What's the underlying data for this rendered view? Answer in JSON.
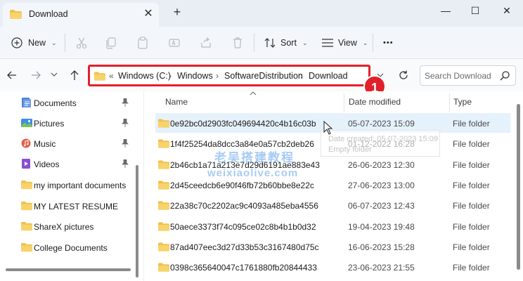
{
  "window": {
    "tab_title": "Download",
    "new_tab_label": "+",
    "close_tab_label": "✕",
    "minimize_label": "—",
    "maximize_label": "☐",
    "close_label": "✕"
  },
  "toolbar": {
    "new_label": "New",
    "sort_label": "Sort",
    "view_label": "View",
    "more_label": "•••"
  },
  "address": {
    "overflow": "«",
    "crumbs": [
      "Windows (C:)",
      "Windows",
      "SoftwareDistribution",
      "Download"
    ],
    "separator": "›"
  },
  "annotation": {
    "badge": "1"
  },
  "search": {
    "placeholder": "Search Download"
  },
  "sidebar": {
    "items": [
      {
        "label": "Documents",
        "icon": "documents-icon",
        "pinned": true
      },
      {
        "label": "Pictures",
        "icon": "pictures-icon",
        "pinned": true
      },
      {
        "label": "Music",
        "icon": "music-icon",
        "pinned": true
      },
      {
        "label": "Videos",
        "icon": "videos-icon",
        "pinned": true
      },
      {
        "label": "my important documents",
        "icon": "folder-icon",
        "pinned": false
      },
      {
        "label": "MY LATEST RESUME",
        "icon": "folder-icon",
        "pinned": false
      },
      {
        "label": "ShareX pictures",
        "icon": "folder-icon",
        "pinned": false
      },
      {
        "label": "College Documents",
        "icon": "folder-icon",
        "pinned": false
      }
    ]
  },
  "columns": {
    "name": "Name",
    "date": "Date modified",
    "type": "Type"
  },
  "rows": [
    {
      "name": "0e92bc0d2903fc049694420c4b16c03b",
      "date": "05-07-2023 15:09",
      "type": "File folder"
    },
    {
      "name": "1f4f25254da8dcc3a84e0a57cb2deb26",
      "date": "01-12-2022 16:28",
      "type": "File folder"
    },
    {
      "name": "2b46cb1a71a213e7d29d6191ae883e43",
      "date": "26-06-2023 12:30",
      "type": "File folder"
    },
    {
      "name": "2d45ceedcb6e90f46fb72b60bbe8e22c",
      "date": "27-06-2023 13:00",
      "type": "File folder"
    },
    {
      "name": "22a38c70c2202ac9c4093a485eba4556",
      "date": "06-07-2023 12:43",
      "type": "File folder"
    },
    {
      "name": "50aece3373f74c095ce02c8b4b1b0d32",
      "date": "19-04-2023 19:48",
      "type": "File folder"
    },
    {
      "name": "87ad407eec3d27d33b53c3167480d75c",
      "date": "16-06-2023 15:28",
      "type": "File folder"
    },
    {
      "name": "0398c365640047c1761880fb20844433",
      "date": "23-06-2023 21:55",
      "type": "File folder"
    }
  ],
  "tooltip": {
    "line1": "Date created: 05-07-2023 15:09",
    "line2": "Empty folder"
  },
  "watermark": {
    "line1": "老吴搭建教程",
    "line2": "weixiaolive.com"
  },
  "colors": {
    "accent_red": "#e2202a",
    "folder_yellow": "#f2c14e",
    "selection": "#e5f1fb"
  }
}
